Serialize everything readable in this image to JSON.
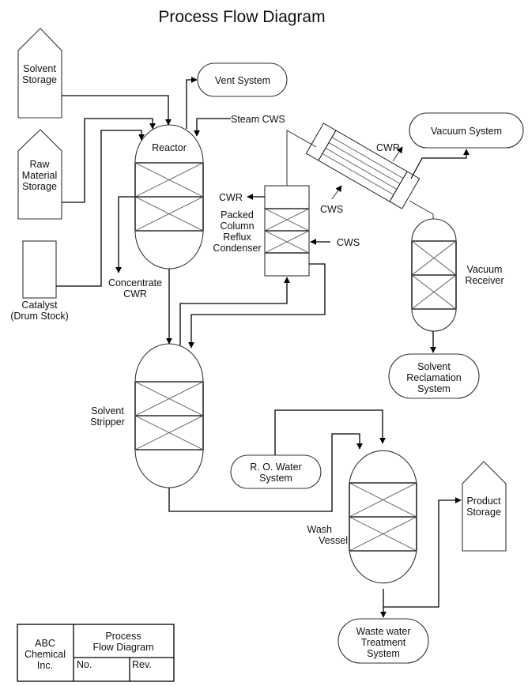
{
  "title": "Process Flow Diagram",
  "equipment": {
    "solvent_storage": [
      "Solvent",
      "Storage"
    ],
    "raw_material_storage": [
      "Raw",
      "Material",
      "Storage"
    ],
    "catalyst": [
      "Catalyst",
      "(Drum Stock)"
    ],
    "reactor": "Reactor",
    "vent_system": "Vent System",
    "packed_column": [
      "Packed",
      "Column",
      "Reflux",
      "Condenser"
    ],
    "vacuum_system": "Vacuum System",
    "vacuum_receiver": [
      "Vacuum",
      "Receiver"
    ],
    "solvent_reclamation": [
      "Solvent",
      "Reclamation",
      "System"
    ],
    "solvent_stripper": [
      "Solvent",
      "Stripper"
    ],
    "ro_water": [
      "R. O. Water",
      "System"
    ],
    "wash_vessel": [
      "Wash",
      "Vessel"
    ],
    "product_storage": [
      "Product",
      "Storage"
    ],
    "waste_water": [
      "Waste water",
      "Treatment",
      "System"
    ]
  },
  "stream_labels": {
    "steam_cws": "Steam CWS",
    "column_cwr": "CWR",
    "column_cws": "CWS",
    "exchanger_cwr": "CWR",
    "exchanger_cws": "CWS",
    "concentrate": [
      "Concentrate",
      "CWR"
    ]
  },
  "title_block": {
    "company": [
      "ABC",
      "Chemical",
      "Inc."
    ],
    "drawing_title": [
      "Process",
      "Flow Diagram"
    ],
    "number_label": "No.",
    "revision_label": "Rev."
  }
}
